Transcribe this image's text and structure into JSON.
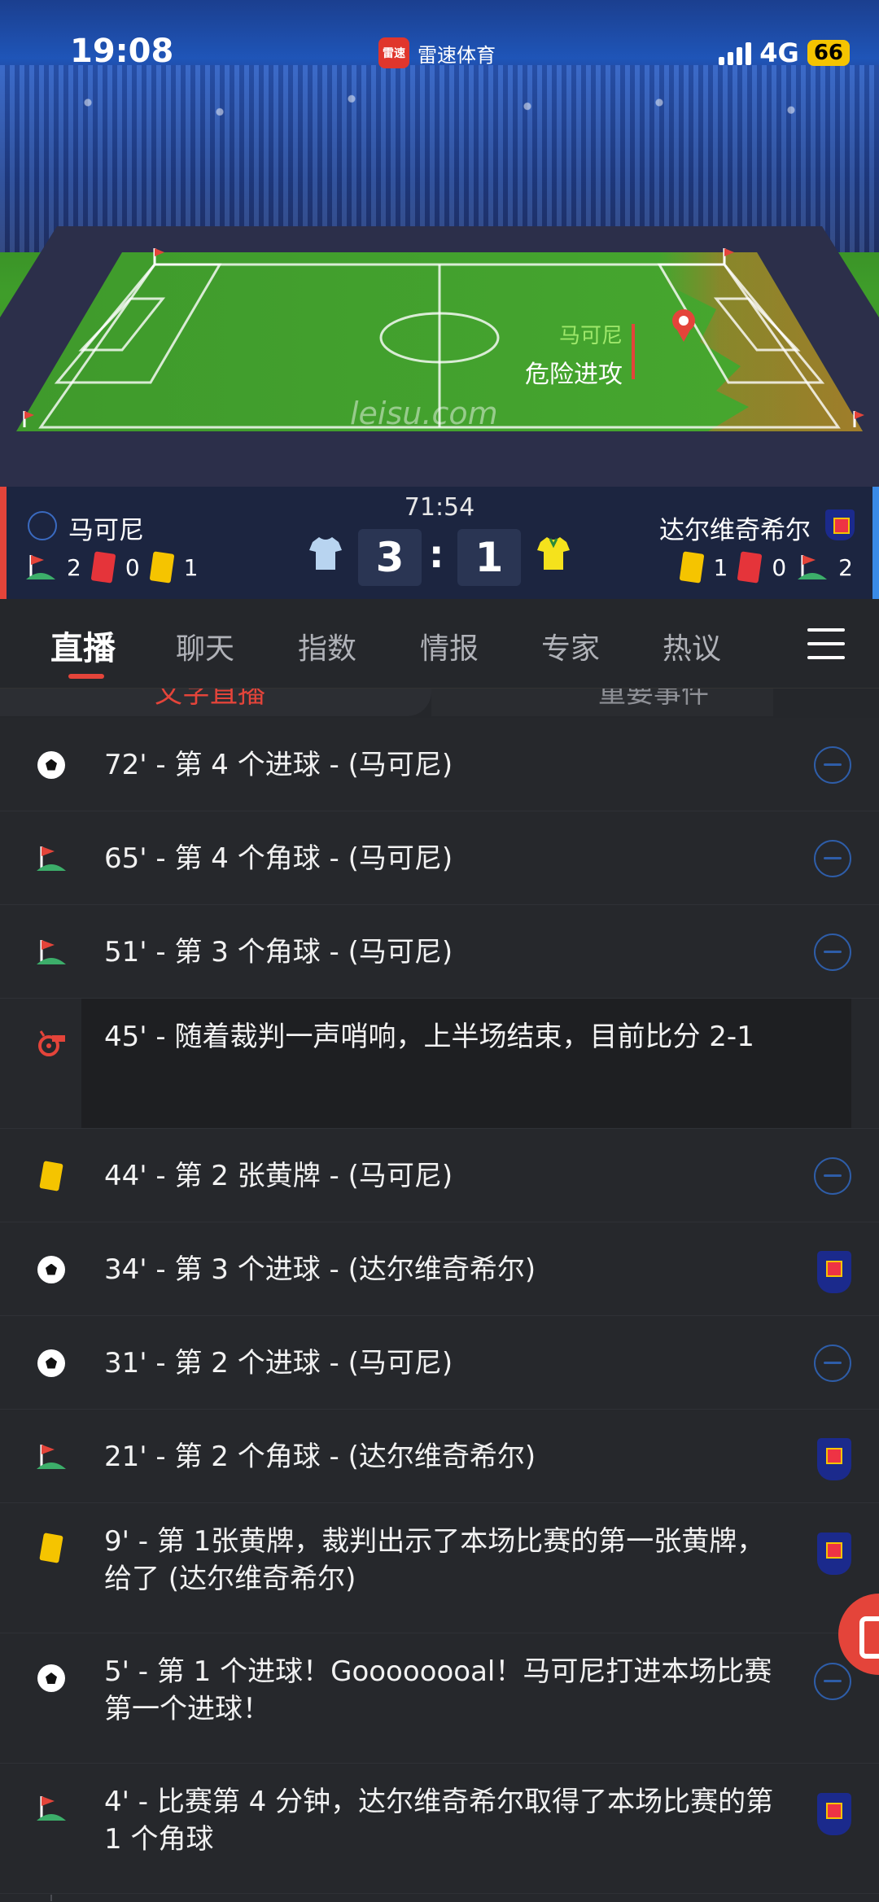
{
  "status_bar": {
    "time": "19:08",
    "app_name": "雷速体育",
    "app_logo_text": "雷速",
    "network": "4G",
    "battery": "66"
  },
  "live_field": {
    "attack_team": "马可尼",
    "attack_text": "危险进攻",
    "watermark": "leisu.com"
  },
  "scoreboard": {
    "match_time": "71:54",
    "home": {
      "name": "马可尼",
      "score": "3",
      "corners": "2",
      "red_cards": "0",
      "yellow_cards": "1",
      "shirt_color": "#b8d4f0"
    },
    "away": {
      "name": "达尔维奇希尔",
      "score": "1",
      "corners": "2",
      "red_cards": "0",
      "yellow_cards": "1",
      "shirt_color": "#f5e21c"
    }
  },
  "nav": {
    "tabs": [
      {
        "label": "直播"
      },
      {
        "label": "聊天"
      },
      {
        "label": "指数"
      },
      {
        "label": "情报"
      },
      {
        "label": "专家"
      },
      {
        "label": "热议"
      }
    ]
  },
  "subtabs": {
    "left": "文字直播",
    "right": "重要事件"
  },
  "events": [
    {
      "icon": "goal",
      "text": "72' - 第 4 个进球 - (马可尼)",
      "team": "home"
    },
    {
      "icon": "corner",
      "text": "65' - 第 4 个角球 - (马可尼)",
      "team": "home"
    },
    {
      "icon": "corner",
      "text": "51' - 第 3 个角球 - (马可尼)",
      "team": "home"
    },
    {
      "icon": "whistle",
      "text": "45' - 随着裁判一声哨响，上半场结束，目前比分 2-1",
      "team": "none"
    },
    {
      "icon": "yellow",
      "text": "44' - 第 2 张黄牌 - (马可尼)",
      "team": "home"
    },
    {
      "icon": "goal",
      "text": "34' - 第 3 个进球 - (达尔维奇希尔)",
      "team": "away"
    },
    {
      "icon": "goal",
      "text": "31' - 第 2 个进球 - (马可尼)",
      "team": "home"
    },
    {
      "icon": "corner",
      "text": "21' - 第 2 个角球 - (达尔维奇希尔)",
      "team": "away"
    },
    {
      "icon": "yellow",
      "text": "9' - 第 1张黄牌，裁判出示了本场比赛的第一张黄牌，给了 (达尔维奇希尔)",
      "team": "away"
    },
    {
      "icon": "goal",
      "text": "5' - 第 1 个进球！Goooooooal！马可尼打进本场比赛第一个进球！",
      "team": "home"
    },
    {
      "icon": "corner",
      "text": "4' - 比赛第 4 分钟，达尔维奇希尔取得了本场比赛的第 1 个角球",
      "team": "away"
    }
  ]
}
